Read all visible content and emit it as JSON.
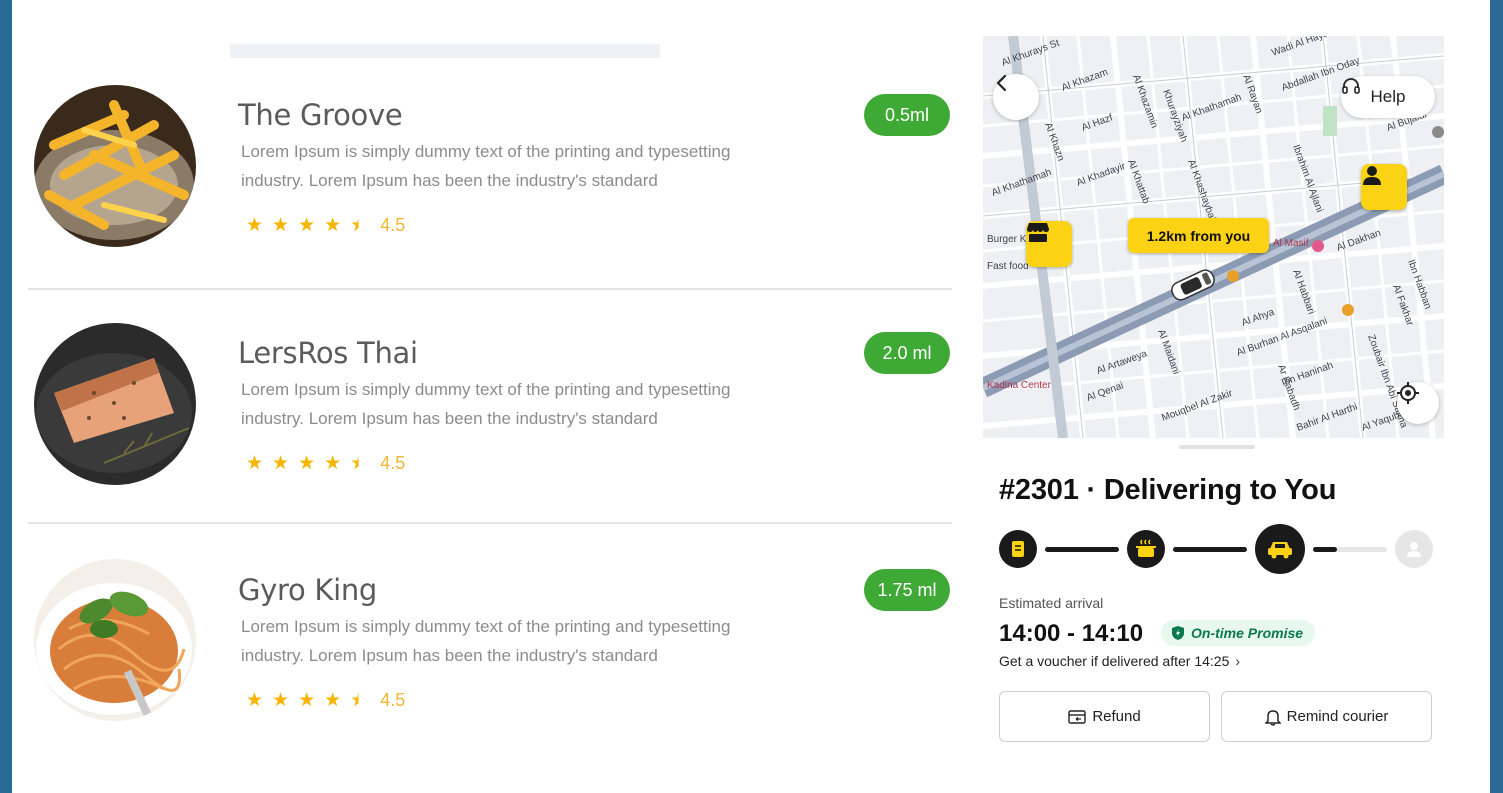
{
  "restaurants": [
    {
      "name": "The Groove",
      "description_line1": "Lorem Ipsum is simply dummy text of the printing and typesetting",
      "description_line2": "industry. Lorem Ipsum has been the industry's standard",
      "rating": 4.5,
      "rating_text": "4.5",
      "badge": "0.5ml",
      "image": "fries"
    },
    {
      "name": "LersRos Thai",
      "description_line1": "Lorem Ipsum is simply dummy text of the printing and typesetting",
      "description_line2": "industry. Lorem Ipsum has been the industry's standard",
      "rating": 4.5,
      "rating_text": "4.5",
      "badge": "2.0 ml",
      "image": "salmon"
    },
    {
      "name": "Gyro King",
      "description_line1": "Lorem Ipsum is simply dummy text of the printing and typesetting",
      "description_line2": "industry. Lorem Ipsum has been the industry's standard",
      "rating": 4.5,
      "rating_text": "4.5",
      "badge": "1.75 ml",
      "image": "spaghetti"
    }
  ],
  "map": {
    "help_label": "Help",
    "distance_label": "1.2km from you",
    "street_labels": [
      "Al Khazam",
      "Al Khazamin",
      "Khurayziyah",
      "Al Rayan",
      "Al Khathamah",
      "Abdallah Ibn Oday",
      "Wadi Al Hayat",
      "Al Hazf",
      "Al Khazn",
      "Al Khattab",
      "Al Khadayir",
      "Al Khashaybah",
      "Ibrahim Al Ajlani",
      "Al Bujaidi",
      "Al Masif",
      "Al Dakhan",
      "Ibn Habban",
      "Al Habbari",
      "Al Ahya",
      "Al Burhan Al Asqalani",
      "Al Maidani",
      "Al Artaweya",
      "Al Qenai",
      "Mouqbel Al Zakir",
      "Ibn Haninah",
      "Ar Rabadh",
      "Bahir Al Harthi",
      "Al Yaqubi",
      "Zoubair Ibn Abi Salma",
      "Al Fakhar",
      "Kadina Center",
      "Burger King"
    ]
  },
  "order": {
    "title": "#2301 · Delivering to You",
    "progress_partial_fraction": 0.33,
    "eta_label": "Estimated arrival",
    "eta_time": "14:00 - 14:10",
    "promise_label": "On-time Promise",
    "voucher_text": "Get a voucher if delivered after 14:25",
    "refund_label": "Refund",
    "remind_label": "Remind courier"
  },
  "colors": {
    "badge_green": "#3fa936",
    "star": "#f7b500",
    "marker_yellow": "#fbd314",
    "promise_green": "#0b7a4a",
    "frame_blue": "#2a6a96"
  }
}
